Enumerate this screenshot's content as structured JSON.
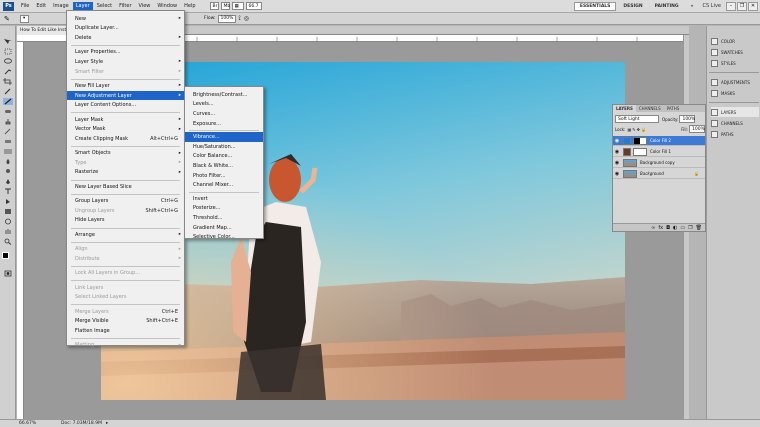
{
  "menubar": {
    "logo": "Ps",
    "items": [
      "File",
      "Edit",
      "Image",
      "Layer",
      "Select",
      "Filter",
      "View",
      "Window",
      "Help"
    ],
    "zoom": "66.7",
    "workspaces": [
      "ESSENTIALS",
      "DESIGN",
      "PAINTING"
    ],
    "more": "»",
    "cs_live": "CS Live"
  },
  "options": {
    "flow_label": "Flow:",
    "flow_value": "100%",
    "opacity_value": "100%"
  },
  "document": {
    "tab_title": "How To Edit Like Instagram @ 66.7% (Color Fill 2, RGB/8) *"
  },
  "layer_menu": {
    "items": [
      {
        "label": "New",
        "arrow": true
      },
      {
        "label": "Duplicate Layer..."
      },
      {
        "label": "Delete",
        "arrow": true
      },
      {
        "sep": true
      },
      {
        "label": "Layer Properties..."
      },
      {
        "label": "Layer Style",
        "arrow": true
      },
      {
        "label": "Smart Filter",
        "arrow": true,
        "disabled": true
      },
      {
        "sep": true
      },
      {
        "label": "New Fill Layer",
        "arrow": true
      },
      {
        "label": "New Adjustment Layer",
        "arrow": true,
        "highlight": true
      },
      {
        "label": "Layer Content Options..."
      },
      {
        "sep": true
      },
      {
        "label": "Layer Mask",
        "arrow": true
      },
      {
        "label": "Vector Mask",
        "arrow": true
      },
      {
        "label": "Create Clipping Mask",
        "shortcut": "Alt+Ctrl+G"
      },
      {
        "sep": true
      },
      {
        "label": "Smart Objects",
        "arrow": true
      },
      {
        "label": "Type",
        "arrow": true,
        "disabled": true
      },
      {
        "label": "Rasterize",
        "arrow": true
      },
      {
        "sep": true
      },
      {
        "label": "New Layer Based Slice"
      },
      {
        "sep": true
      },
      {
        "label": "Group Layers",
        "shortcut": "Ctrl+G"
      },
      {
        "label": "Ungroup Layers",
        "shortcut": "Shift+Ctrl+G",
        "disabled": true
      },
      {
        "label": "Hide Layers"
      },
      {
        "sep": true
      },
      {
        "label": "Arrange",
        "arrow": true
      },
      {
        "sep": true
      },
      {
        "label": "Align",
        "arrow": true,
        "disabled": true
      },
      {
        "label": "Distribute",
        "arrow": true,
        "disabled": true
      },
      {
        "sep": true
      },
      {
        "label": "Lock All Layers in Group...",
        "disabled": true
      },
      {
        "sep": true
      },
      {
        "label": "Link Layers",
        "disabled": true
      },
      {
        "label": "Select Linked Layers",
        "disabled": true
      },
      {
        "sep": true
      },
      {
        "label": "Merge Layers",
        "shortcut": "Ctrl+E",
        "disabled": true
      },
      {
        "label": "Merge Visible",
        "shortcut": "Shift+Ctrl+E"
      },
      {
        "label": "Flatten Image"
      },
      {
        "sep": true
      },
      {
        "label": "Matting",
        "arrow": true,
        "disabled": true
      }
    ]
  },
  "adjustment_menu": {
    "items": [
      {
        "label": "Brightness/Contrast..."
      },
      {
        "label": "Levels..."
      },
      {
        "label": "Curves..."
      },
      {
        "label": "Exposure..."
      },
      {
        "sep": true
      },
      {
        "label": "Vibrance...",
        "highlight": true
      },
      {
        "label": "Hue/Saturation..."
      },
      {
        "label": "Color Balance..."
      },
      {
        "label": "Black & White..."
      },
      {
        "label": "Photo Filter..."
      },
      {
        "label": "Channel Mixer..."
      },
      {
        "sep": true
      },
      {
        "label": "Invert"
      },
      {
        "label": "Posterize..."
      },
      {
        "label": "Threshold..."
      },
      {
        "label": "Gradient Map..."
      },
      {
        "label": "Selective Color..."
      }
    ]
  },
  "layers_panel": {
    "tabs": [
      "LAYERS",
      "CHANNELS",
      "PATHS"
    ],
    "blend_mode": "Soft Light",
    "opacity_label": "Opacity:",
    "opacity": "100%",
    "lock_label": "Lock:",
    "fill_label": "Fill:",
    "fill": "100%",
    "layers": [
      {
        "name": "Color Fill 2",
        "selected": true
      },
      {
        "name": "Color Fill 1"
      },
      {
        "name": "Background copy"
      },
      {
        "name": "Background"
      }
    ]
  },
  "right_panel": {
    "groups": [
      [
        "COLOR",
        "SWATCHES",
        "STYLES"
      ],
      [
        "ADJUSTMENTS",
        "MASKS"
      ],
      [
        "LAYERS",
        "CHANNELS",
        "PATHS"
      ]
    ]
  },
  "status": {
    "zoom": "66.67%",
    "doc": "Doc: 7.03M/18.9M"
  }
}
